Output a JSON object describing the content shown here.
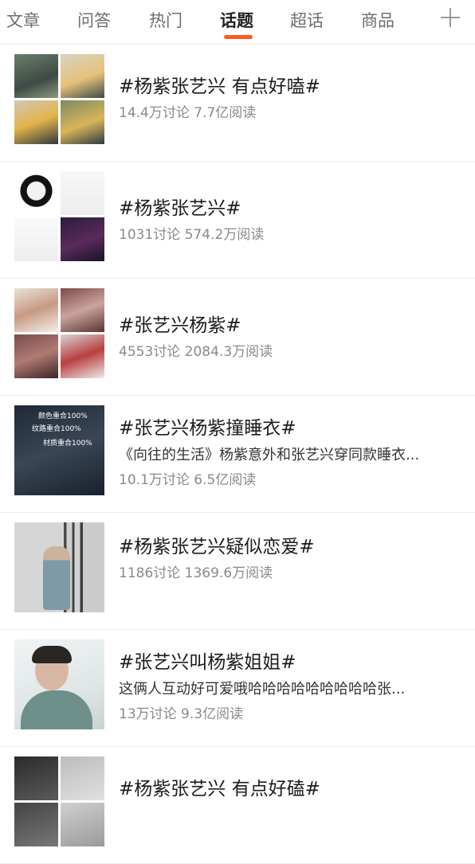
{
  "tabs": [
    {
      "label": "文章",
      "active": false
    },
    {
      "label": "问答",
      "active": false
    },
    {
      "label": "热门",
      "active": false
    },
    {
      "label": "话题",
      "active": true
    },
    {
      "label": "超话",
      "active": false
    },
    {
      "label": "商品",
      "active": false
    }
  ],
  "accent_color": "#ff5a1f",
  "add_icon": "plus-icon",
  "topics": [
    {
      "title": "#杨紫张艺兴 有点好嗑#",
      "desc": "",
      "stats": "14.4万讨论 7.7亿阅读"
    },
    {
      "title": "#杨紫张艺兴#",
      "desc": "",
      "stats": "1031讨论 574.2万阅读"
    },
    {
      "title": "#张艺兴杨紫#",
      "desc": "",
      "stats": "4553讨论 2084.3万阅读"
    },
    {
      "title": "#张艺兴杨紫撞睡衣#",
      "desc": "《向往的生活》杨紫意外和张艺兴穿同款睡衣...",
      "stats": "10.1万讨论 6.5亿阅读"
    },
    {
      "title": "#杨紫张艺兴疑似恋爱#",
      "desc": "",
      "stats": "1186讨论 1369.6万阅读"
    },
    {
      "title": "#张艺兴叫杨紫姐姐#",
      "desc": "这俩人互动好可爱哦哈哈哈哈哈哈哈哈哈张...",
      "stats": "13万讨论 9.3亿阅读"
    },
    {
      "title": "#杨紫张艺兴 有点好磕#",
      "desc": "",
      "stats": ""
    }
  ],
  "thumb_overlay": {
    "line1": "颜色重合100%",
    "line2": "纹路重合100%",
    "line3": "材质重合100%"
  }
}
